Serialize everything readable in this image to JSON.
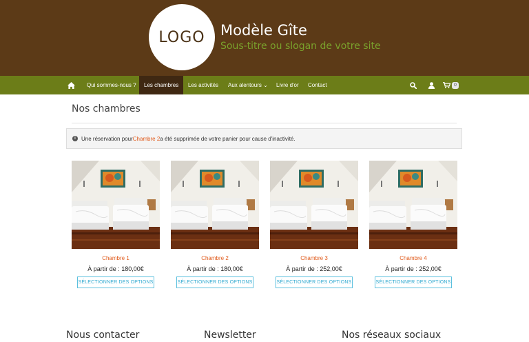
{
  "header": {
    "logo_text": "LOGO",
    "site_title": "Modèle Gîte",
    "site_slogan": "Sous-titre ou slogan de votre site",
    "background_color": "#5c3a17",
    "slogan_color": "#7aa22c"
  },
  "nav": {
    "home_icon": "home-icon",
    "items": [
      {
        "label": "Qui sommes-nous ?"
      },
      {
        "label": "Les chambres",
        "active": true
      },
      {
        "label": "Les activités"
      },
      {
        "label": "Aux alentours ⌄"
      },
      {
        "label": "Livre d'or"
      },
      {
        "label": "Contact"
      }
    ],
    "search_icon": "search-icon",
    "account_icon": "user-icon",
    "cart_icon": "cart-icon",
    "cart_count": "0",
    "background_color": "#6c7d18"
  },
  "page": {
    "title": "Nos chambres"
  },
  "notice": {
    "icon": "info-icon",
    "text_before": "Une réservation pour ",
    "link_text": "Chambre 2",
    "text_after": " a été supprimée de votre panier pour cause d'inactivité."
  },
  "products": [
    {
      "name": "Chambre 1",
      "price": "À partir de : 180,00€",
      "button": "SÉLECTIONNER DES OPTIONS"
    },
    {
      "name": "Chambre 2",
      "price": "À partir de : 180,00€",
      "button": "SÉLECTIONNER DES OPTIONS"
    },
    {
      "name": "Chambre 3",
      "price": "À partir de : 252,00€",
      "button": "SÉLECTIONNER DES OPTIONS"
    },
    {
      "name": "Chambre 4",
      "price": "À partir de : 252,00€",
      "button": "SÉLECTIONNER DES OPTIONS"
    }
  ],
  "footer": {
    "contact_heading": "Nous contacter",
    "newsletter_heading": "Newsletter",
    "social_heading": "Nos réseaux sociaux"
  }
}
